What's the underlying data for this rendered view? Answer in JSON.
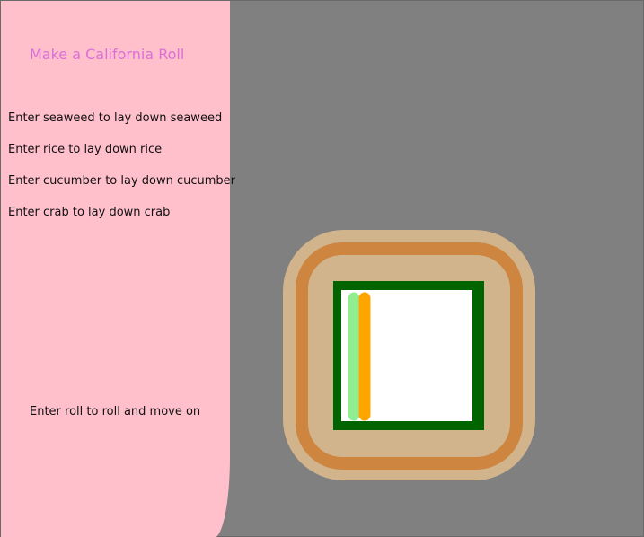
{
  "title": "Make a California Roll",
  "instructions": [
    "Enter seaweed to lay down seaweed",
    "Enter rice to lay down rice",
    "Enter cucumber to lay down cucumber",
    "Enter crab to lay down crab"
  ],
  "roll_instruction": "Enter roll to roll and move on",
  "colors": {
    "sidebar": "#ffc0cb",
    "title": "#da70d6",
    "background": "#808080",
    "mat_outer": "#d2b48c",
    "mat_ring": "#cd853f",
    "seaweed": "#006400",
    "rice": "#ffffff",
    "cucumber": "#90ee90",
    "crab": "#ffa500"
  }
}
